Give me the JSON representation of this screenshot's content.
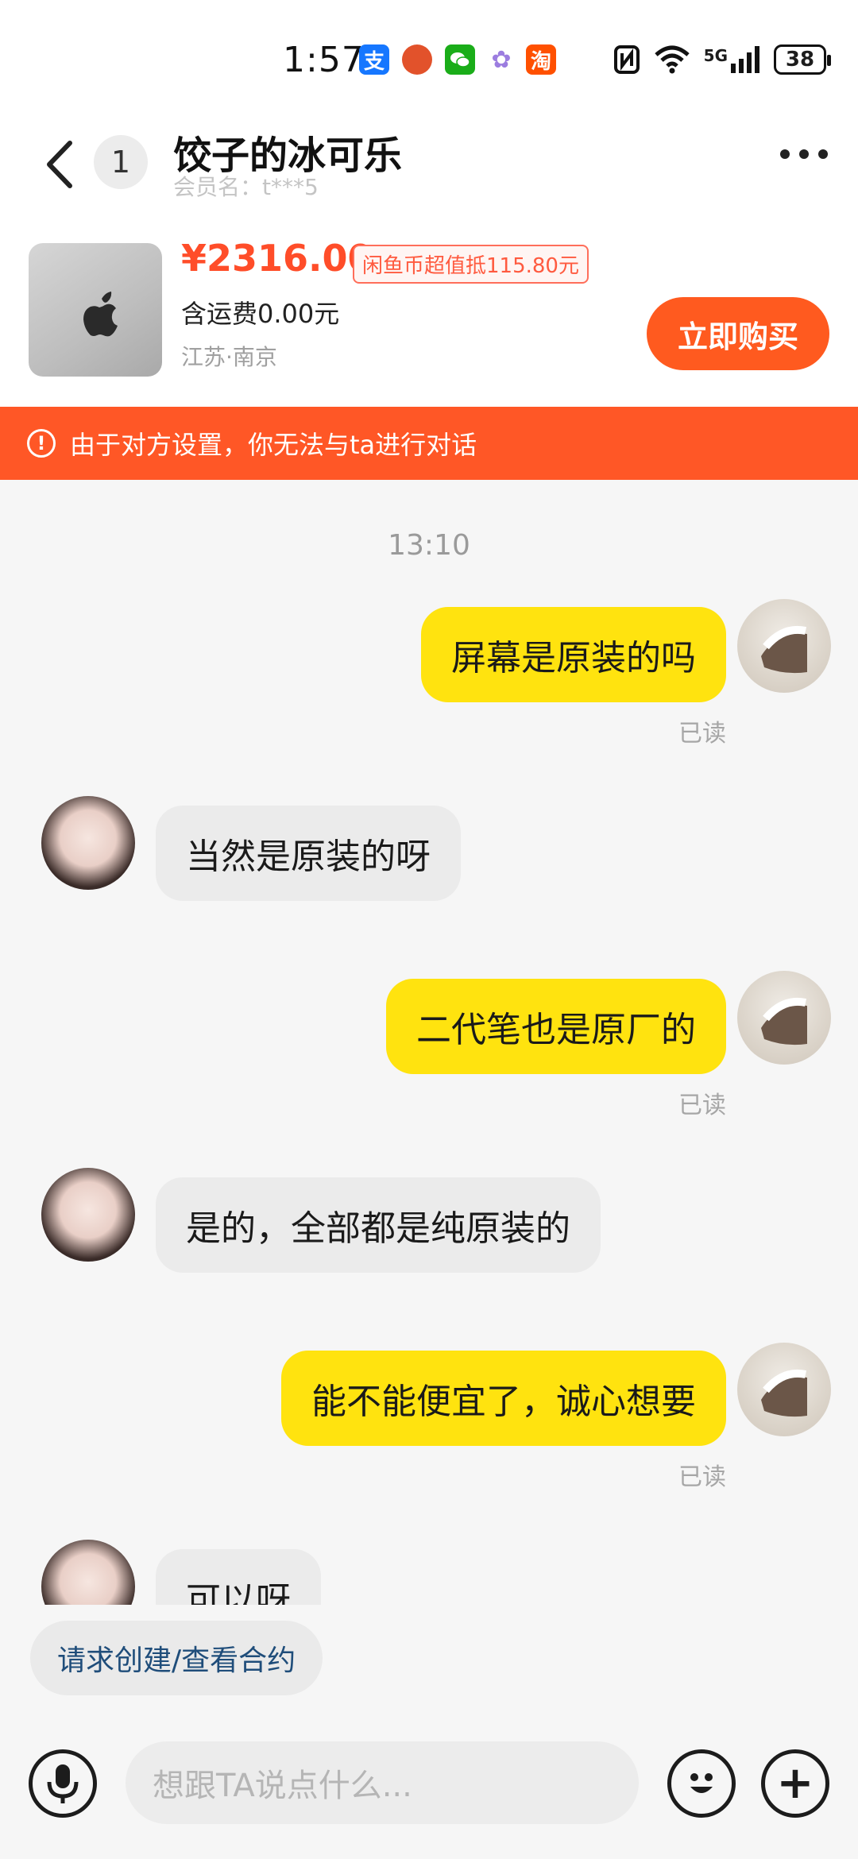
{
  "status_bar": {
    "time": "1:57",
    "apps": [
      {
        "icon": "alipay-icon",
        "glyph": "支",
        "color": "#1677ff"
      },
      {
        "icon": "game-icon",
        "glyph": "●",
        "color": "#e2522b"
      },
      {
        "icon": "wechat-icon",
        "glyph": "●",
        "color": "#1aad19"
      },
      {
        "icon": "photos-icon",
        "glyph": "✿",
        "color": "#9c7de0"
      },
      {
        "icon": "taobao-icon",
        "glyph": "淘",
        "color": "#ff5000"
      }
    ],
    "network": "5G",
    "battery": "38"
  },
  "header": {
    "unread_count": "1",
    "title": "饺子的冰可乐",
    "member_name": "会员名：t***5"
  },
  "product": {
    "price": "¥2316.00",
    "coin_tag": "闲鱼币超值抵115.80元",
    "shipping": "含运费0.00元",
    "location": "江苏·南京",
    "buy_label": "立即购买"
  },
  "warning": {
    "text": "由于对方设置，你无法与ta进行对话"
  },
  "chat": {
    "timestamp": "13:10",
    "messages": [
      {
        "from": "me",
        "text": "屏幕是原装的吗",
        "status": "已读"
      },
      {
        "from": "them",
        "text": "当然是原装的呀"
      },
      {
        "from": "me",
        "text": "二代笔也是原厂的",
        "status": "已读"
      },
      {
        "from": "them",
        "text": "是的，全部都是纯原装的"
      },
      {
        "from": "me",
        "text": "能不能便宜了，诚心想要",
        "status": "已读"
      },
      {
        "from": "them",
        "text": "可以呀"
      }
    ]
  },
  "contract_button": "请求创建/查看合约",
  "input": {
    "placeholder": "想跟TA说点什么..."
  },
  "colors": {
    "accent": "#ff5a1f",
    "outgoing_bubble": "#ffe30f",
    "incoming_bubble": "#ebebeb",
    "price": "#ff4d29"
  }
}
